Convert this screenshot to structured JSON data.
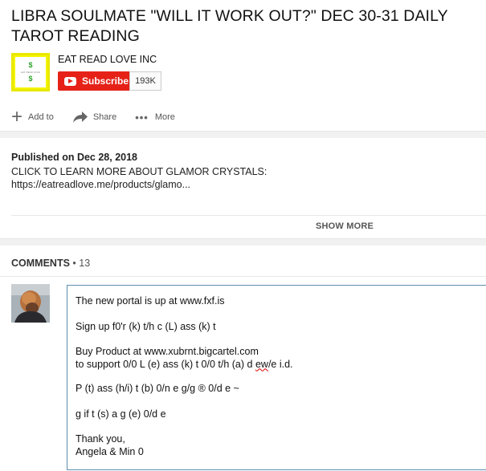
{
  "video": {
    "title": "LIBRA SOULMATE \"WILL IT WORK OUT?\" DEC 30-31 DAILY TAROT READING"
  },
  "channel": {
    "name": "EAT READ LOVE INC",
    "logo_top": "$",
    "logo_mid": "EAT READ LOVE",
    "logo_bottom": "$",
    "subscribe_label": "Subscribe",
    "subscriber_count": "193K"
  },
  "actions": {
    "add_to": "Add to",
    "share": "Share",
    "more": "More"
  },
  "description": {
    "published": "Published on Dec 28, 2018",
    "line1": "CLICK TO LEARN MORE ABOUT GLAMOR CRYSTALS:",
    "line2": "https://eatreadlove.me/products/glamo...",
    "show_more": "SHOW MORE"
  },
  "comments": {
    "label": "COMMENTS",
    "separator": "•",
    "count": "13"
  },
  "popup": {
    "line1": "The new portal is up at www.fxf.is",
    "line2": "Sign up f0'r (k) t/h c (L) ass (k) t",
    "line3a": "Buy Product at www.xubrnt.bigcartel.com",
    "line3b_pre": "to support 0/0 L (e) ass (k) t 0/0 t/h (a) d ",
    "line3b_sq": "ew",
    "line3b_post": "/e i.d.",
    "line4": "P (t) ass (h/i) t (b) 0/n e g/g ® 0/d e ~",
    "line5": "g if t (s) a g (e) 0/d e",
    "line6a": "Thank you,",
    "line6b": "Angela & Min 0"
  },
  "colors": {
    "subscribe_red": "#e62117",
    "popup_border": "#5c8eb0",
    "logo_yellow": "#f5f500"
  }
}
